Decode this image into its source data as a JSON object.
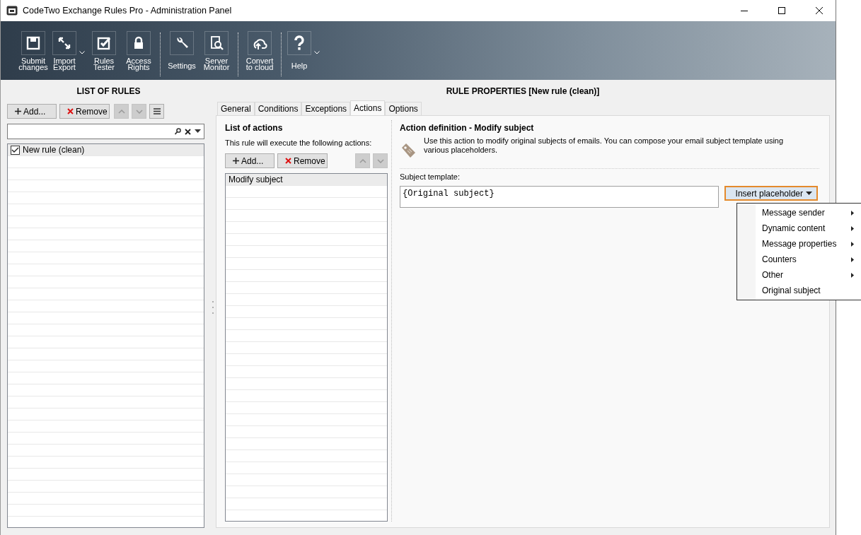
{
  "window": {
    "title": "CodeTwo Exchange Rules Pro - Administration Panel"
  },
  "toolbar": {
    "groups": [
      [
        {
          "label_lines": [
            "Submit",
            "changes"
          ],
          "dropdown": false
        },
        {
          "label_lines": [
            "Import",
            "Export"
          ],
          "dropdown": true
        },
        {
          "label_lines": [
            "Rules",
            "Tester"
          ],
          "dropdown": false
        },
        {
          "label_lines": [
            "Access",
            "Rights"
          ],
          "dropdown": false
        }
      ],
      [
        {
          "label_lines": [
            "Settings"
          ],
          "dropdown": false
        },
        {
          "label_lines": [
            "Server",
            "Monitor"
          ],
          "dropdown": false
        }
      ],
      [
        {
          "label_lines": [
            "Convert",
            "to cloud"
          ],
          "dropdown": false
        }
      ],
      [
        {
          "label_lines": [
            "Help"
          ],
          "dropdown": true
        }
      ]
    ]
  },
  "rules_panel": {
    "heading": "LIST OF RULES",
    "buttons": [
      {
        "kind": "add",
        "label": "Add..."
      },
      {
        "kind": "remove",
        "label": "Remove"
      }
    ],
    "move_up": {
      "disabled": true
    },
    "move_down": {
      "disabled": true
    },
    "rules": [
      {
        "label": "New rule (clean)",
        "checked": true,
        "selected": true
      }
    ]
  },
  "properties": {
    "heading": "RULE PROPERTIES [New rule (clean)]",
    "tabs": [
      {
        "label": "General",
        "selected": false
      },
      {
        "label": "Conditions",
        "selected": false
      },
      {
        "label": "Exceptions",
        "selected": false
      },
      {
        "label": "Actions",
        "selected": true
      },
      {
        "label": "Options",
        "selected": false
      }
    ],
    "actions": {
      "title": "List of actions",
      "description": "This rule will execute the following actions:",
      "buttons": [
        {
          "kind": "add",
          "label": "Add..."
        },
        {
          "kind": "remove",
          "label": "Remove"
        }
      ],
      "move_up": {
        "disabled": true
      },
      "move_down": {
        "disabled": true
      },
      "items": [
        {
          "label": "Modify subject",
          "selected": true
        }
      ]
    },
    "definition": {
      "title": "Action definition - Modify subject",
      "description": "Use this action to modify original subjects of emails. You can compose your email subject template using various placeholders.",
      "field_label": "Subject template:",
      "field_value": "{Original subject}",
      "insert_button": "Insert placeholder",
      "menu": [
        {
          "label": "Message sender",
          "submenu": true
        },
        {
          "label": "Dynamic content",
          "submenu": true
        },
        {
          "label": "Message properties",
          "submenu": true
        },
        {
          "label": "Counters",
          "submenu": true
        },
        {
          "label": "Other",
          "submenu": true
        },
        {
          "label": "Original subject",
          "submenu": false
        }
      ]
    }
  }
}
